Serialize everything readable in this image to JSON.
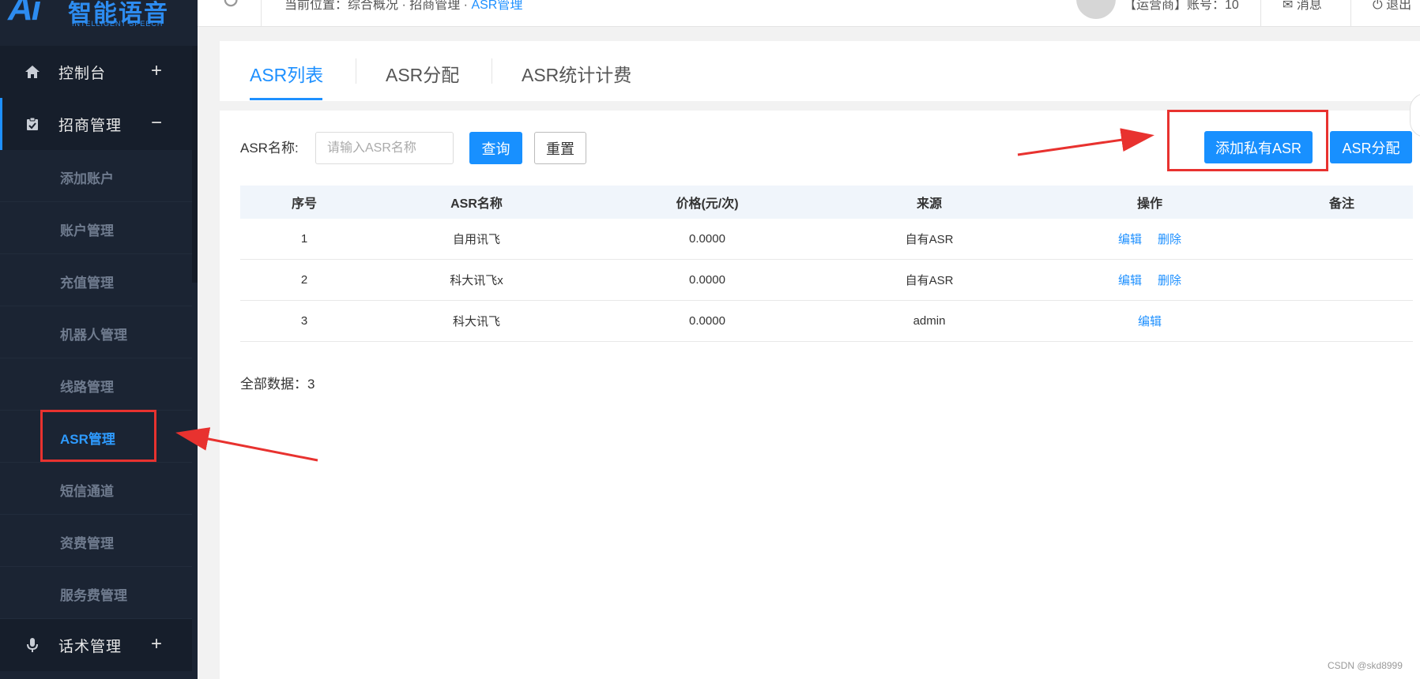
{
  "logo": {
    "mark": "Ai",
    "name": "智能语音",
    "sub": "INTELLIGENT SPEECH"
  },
  "sidebar": {
    "groups": [
      {
        "label": "控制台",
        "toggle": "+",
        "icon": "home-icon"
      },
      {
        "label": "招商管理",
        "toggle": "−",
        "icon": "clipboard-icon"
      },
      {
        "label": "话术管理",
        "toggle": "+",
        "icon": "microphone-icon"
      }
    ],
    "items": [
      {
        "label": "添加账户"
      },
      {
        "label": "账户管理"
      },
      {
        "label": "充值管理"
      },
      {
        "label": "机器人管理"
      },
      {
        "label": "线路管理"
      },
      {
        "label": "ASR管理"
      },
      {
        "label": "短信通道"
      },
      {
        "label": "资费管理"
      },
      {
        "label": "服务费管理"
      }
    ]
  },
  "header": {
    "breadcrumb_prefix": "当前位置：综合概况 · 招商管理 · ",
    "breadcrumb_current": "ASR管理",
    "user": "【运营商】账号：10",
    "messages": "消息",
    "logout": "退出"
  },
  "tabs": [
    {
      "label": "ASR列表",
      "active": true
    },
    {
      "label": "ASR分配",
      "active": false
    },
    {
      "label": "ASR统计计费",
      "active": false
    }
  ],
  "search": {
    "label": "ASR名称:",
    "placeholder": "请输入ASR名称",
    "value": "",
    "query_label": "查询",
    "reset_label": "重置"
  },
  "actions": {
    "add_private": "添加私有ASR",
    "assign": "ASR分配"
  },
  "table": {
    "columns": [
      "序号",
      "ASR名称",
      "价格(元/次)",
      "来源",
      "操作",
      "备注"
    ],
    "rows": [
      {
        "no": "1",
        "name": "自用讯飞",
        "price": "0.0000",
        "source": "自有ASR",
        "edit": "编辑",
        "delete": "删除",
        "note": ""
      },
      {
        "no": "2",
        "name": "科大讯飞x",
        "price": "0.0000",
        "source": "自有ASR",
        "edit": "编辑",
        "delete": "删除",
        "note": ""
      },
      {
        "no": "3",
        "name": "科大讯飞",
        "price": "0.0000",
        "source": "admin",
        "edit": "编辑",
        "delete": "",
        "note": ""
      }
    ]
  },
  "footer": {
    "total": "全部数据：3"
  },
  "watermark": "CSDN @skd8999",
  "colors": {
    "primary": "#1890ff",
    "sidebar_bg": "#1b2433",
    "annotation_red": "#e8322f"
  }
}
